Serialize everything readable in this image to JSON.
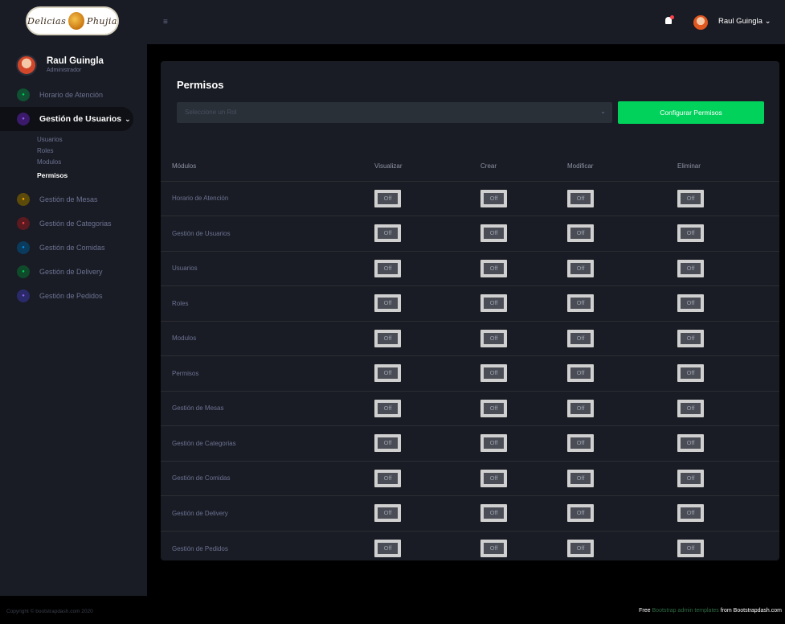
{
  "brand": {
    "logo_text": "Delicias Phujia"
  },
  "sidebar": {
    "profile": {
      "name": "Raul Guingla",
      "role": "Administrador"
    },
    "nav": [
      {
        "label": "Horario de Atención",
        "icon": "clock-icon",
        "color": "#0f5132",
        "fg": "#00d25b"
      },
      {
        "label": "Gestión de Usuarios",
        "icon": "users-icon",
        "color": "#3b1a6b",
        "fg": "#8f5fe8",
        "active": true,
        "caret": "⌄"
      },
      {
        "label": "Gestión de Mesas",
        "icon": "table-icon",
        "color": "#5c4a0a",
        "fg": "#ffab00"
      },
      {
        "label": "Gestión de Categorias",
        "icon": "category-icon",
        "color": "#5a1a1f",
        "fg": "#fc424a"
      },
      {
        "label": "Gestión de Comidas",
        "icon": "food-icon",
        "color": "#0a3a5c",
        "fg": "#0090e7"
      },
      {
        "label": "Gestión de Delivery",
        "icon": "delivery-icon",
        "color": "#0f4a2a",
        "fg": "#00d25b"
      },
      {
        "label": "Gestión de Pedidos",
        "icon": "orders-icon",
        "color": "#2a2a6b",
        "fg": "#8f5fe8"
      }
    ],
    "submenu": [
      "Usuarios",
      "Roles",
      "Modulos",
      "Permisos"
    ]
  },
  "navbar": {
    "toggle": "≡",
    "user_name": "Raul Guingla",
    "caret": "⌄"
  },
  "card": {
    "title": "Permisos",
    "select_placeholder": "Seleccione un Rol",
    "select_arrow": "⌄",
    "button_label": "Configurar Permisos",
    "columns": [
      "Módulos",
      "Visualizar",
      "Crear",
      "Modificar",
      "Eliminar"
    ],
    "rows": [
      {
        "module": "Horario de Atención",
        "toggles": [
          "Off",
          "Off",
          "Off",
          "Off"
        ]
      },
      {
        "module": "Gestión de Usuarios",
        "toggles": [
          "Off",
          "Off",
          "Off",
          "Off"
        ]
      },
      {
        "module": "Usuarios",
        "toggles": [
          "Off",
          "Off",
          "Off",
          "Off"
        ]
      },
      {
        "module": "Roles",
        "toggles": [
          "Off",
          "Off",
          "Off",
          "Off"
        ]
      },
      {
        "module": "Modulos",
        "toggles": [
          "Off",
          "Off",
          "Off",
          "Off"
        ]
      },
      {
        "module": "Permisos",
        "toggles": [
          "Off",
          "Off",
          "Off",
          "Off"
        ]
      },
      {
        "module": "Gestión de Mesas",
        "toggles": [
          "Off",
          "Off",
          "Off",
          "Off"
        ]
      },
      {
        "module": "Gestión de Categorias",
        "toggles": [
          "Off",
          "Off",
          "Off",
          "Off"
        ]
      },
      {
        "module": "Gestión de Comidas",
        "toggles": [
          "Off",
          "Off",
          "Off",
          "Off"
        ]
      },
      {
        "module": "Gestión de Delivery",
        "toggles": [
          "Off",
          "Off",
          "Off",
          "Off"
        ]
      },
      {
        "module": "Gestión de Pedidos",
        "toggles": [
          "Off",
          "Off",
          "Off",
          "Off"
        ]
      }
    ]
  },
  "footer": {
    "copyright": "Copyright © bootstrapdash.com 2020",
    "free": "Free",
    "link_text": "Bootstrap admin templates",
    "from": "from Bootstrapdash.com"
  }
}
